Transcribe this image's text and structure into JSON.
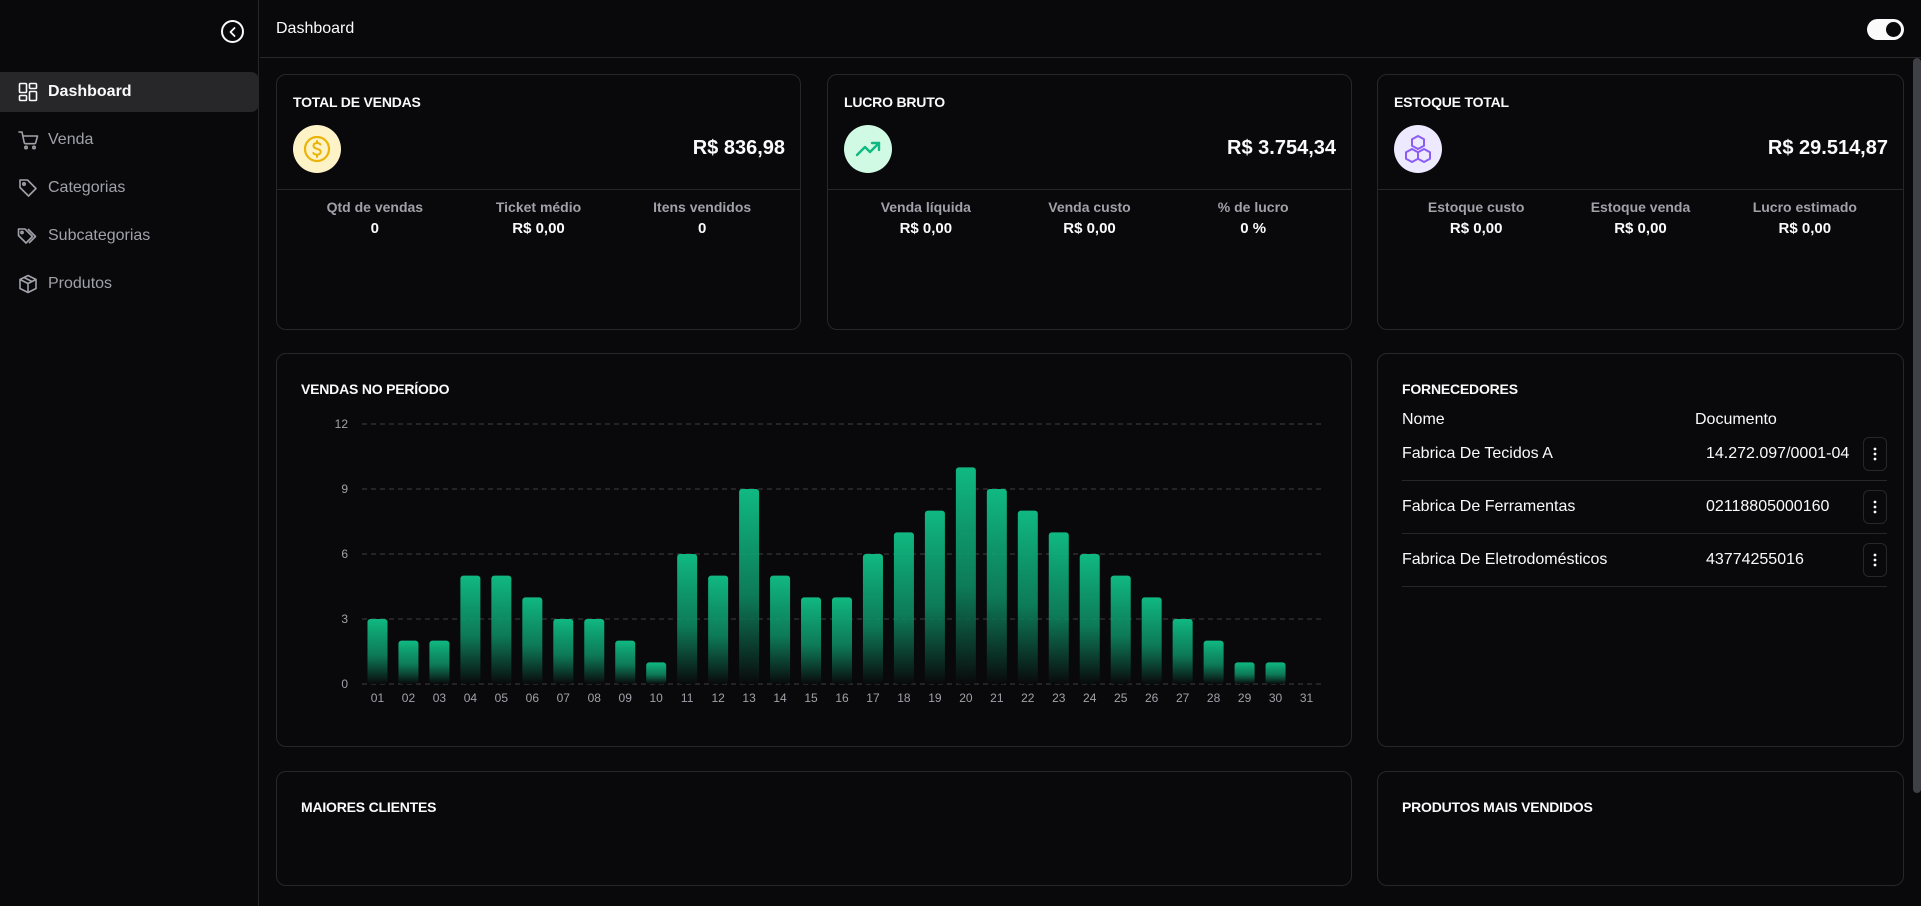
{
  "sidebar": {
    "items": [
      {
        "label": "Dashboard",
        "icon": "dashboard-icon"
      },
      {
        "label": "Venda",
        "icon": "cart-icon"
      },
      {
        "label": "Categorias",
        "icon": "tag-icon"
      },
      {
        "label": "Subcategorias",
        "icon": "tags-icon"
      },
      {
        "label": "Produtos",
        "icon": "package-icon"
      }
    ]
  },
  "header": {
    "title": "Dashboard"
  },
  "stats": [
    {
      "title": "TOTAL DE VENDAS",
      "value": "R$ 836,98",
      "icon": "coin-icon",
      "icon_bg": "#fef3c7",
      "icon_color": "#eab308",
      "sub": [
        {
          "label": "Qtd de vendas",
          "value": "0"
        },
        {
          "label": "Ticket médio",
          "value": "R$ 0,00"
        },
        {
          "label": "Itens vendidos",
          "value": "0"
        }
      ]
    },
    {
      "title": "LUCRO BRUTO",
      "value": "R$ 3.754,34",
      "icon": "trending-up-icon",
      "icon_bg": "#d1fae5",
      "icon_color": "#10b981",
      "sub": [
        {
          "label": "Venda líquida",
          "value": "R$ 0,00"
        },
        {
          "label": "Venda custo",
          "value": "R$ 0,00"
        },
        {
          "label": "% de lucro",
          "value": "0 %"
        }
      ]
    },
    {
      "title": "ESTOQUE TOTAL",
      "value": "R$ 29.514,87",
      "icon": "boxes-icon",
      "icon_bg": "#ede9fe",
      "icon_color": "#8b5cf6",
      "sub": [
        {
          "label": "Estoque custo",
          "value": "R$ 0,00"
        },
        {
          "label": "Estoque venda",
          "value": "R$ 0,00"
        },
        {
          "label": "Lucro estimado",
          "value": "R$ 0,00"
        }
      ]
    }
  ],
  "chart_data": {
    "type": "bar",
    "title": "VENDAS NO PERÍODO",
    "categories": [
      "01",
      "02",
      "03",
      "04",
      "05",
      "06",
      "07",
      "08",
      "09",
      "10",
      "11",
      "12",
      "13",
      "14",
      "15",
      "16",
      "17",
      "18",
      "19",
      "20",
      "21",
      "22",
      "23",
      "24",
      "25",
      "26",
      "27",
      "28",
      "29",
      "30",
      "31"
    ],
    "values": [
      3,
      2,
      2,
      5,
      5,
      4,
      3,
      3,
      2,
      1,
      6,
      5,
      9,
      5,
      4,
      4,
      6,
      7,
      8,
      10,
      9,
      8,
      7,
      6,
      5,
      4,
      3,
      2,
      1,
      1,
      0
    ],
    "yticks": [
      0,
      3,
      6,
      9,
      12
    ],
    "ylim": [
      0,
      12
    ],
    "grid": true,
    "bar_color": "#10b981"
  },
  "fornecedores": {
    "title": "FORNECEDORES",
    "columns": [
      "Nome",
      "Documento"
    ],
    "rows": [
      {
        "nome": "Fabrica De Tecidos A",
        "documento": "14.272.097/0001-04"
      },
      {
        "nome": "Fabrica De Ferramentas",
        "documento": "02118805000160"
      },
      {
        "nome": "Fabrica De Eletrodomésticos",
        "documento": "43774255016"
      }
    ]
  },
  "maiores_clientes": {
    "title": "MAIORES CLIENTES"
  },
  "produtos_mais_vendidos": {
    "title": "PRODUTOS MAIS VENDIDOS"
  }
}
